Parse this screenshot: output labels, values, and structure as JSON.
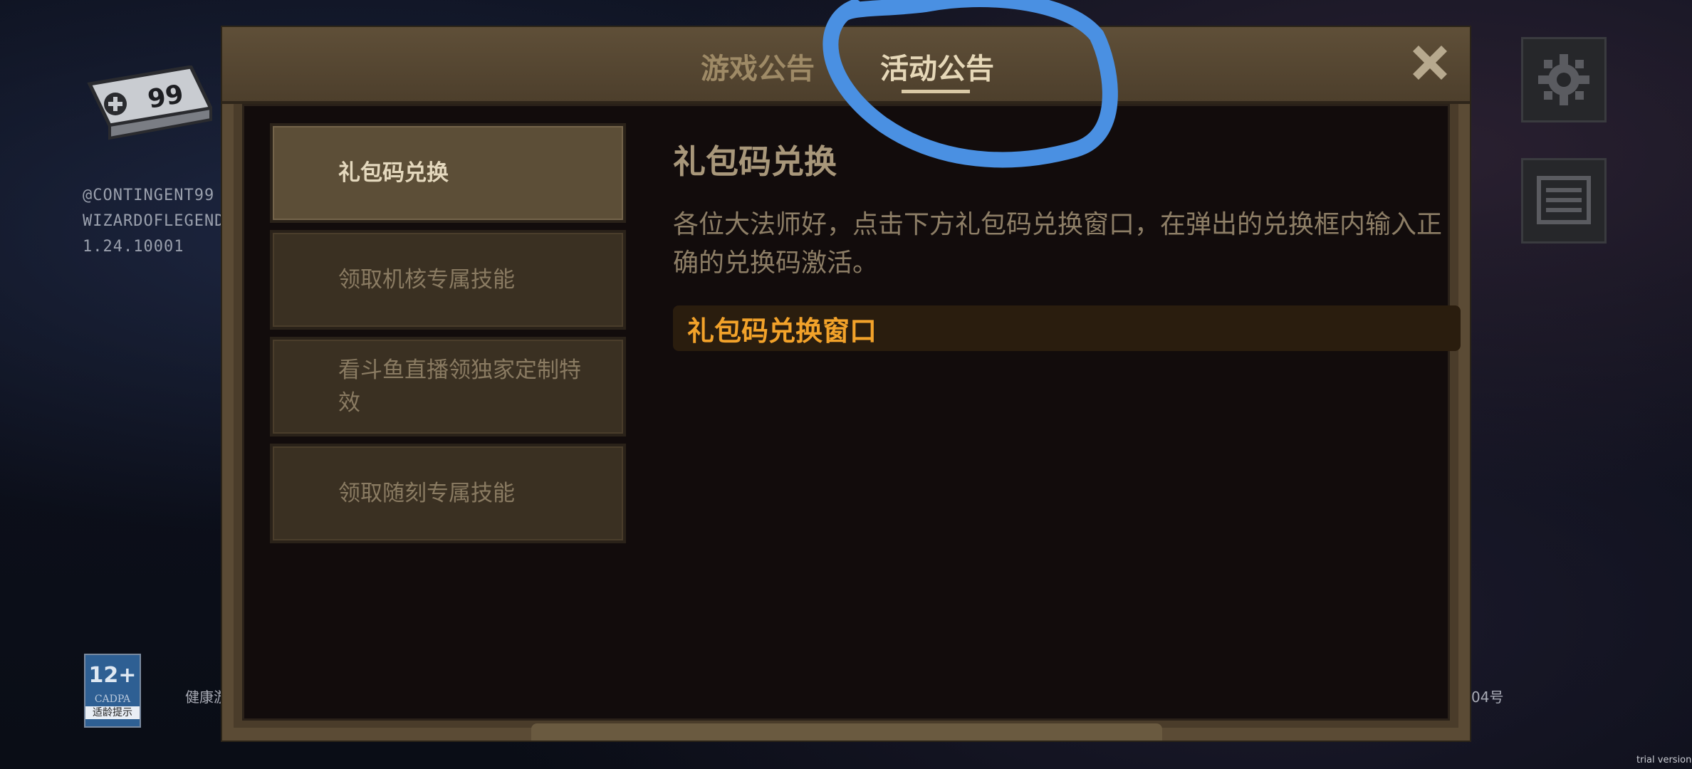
{
  "left_panel": {
    "controller_count": "99",
    "credit_line_1": "@CONTINGENT99",
    "credit_line_2": "WIZARDOFLEGEND",
    "version": "1.24.10001",
    "age_rating": {
      "number": "12+",
      "org": "CADPA",
      "tip": "适龄提示"
    },
    "health_text_visible": "健康游",
    "license_text_visible": "04号",
    "trial_label": "trial version"
  },
  "right_panel": {
    "settings_icon": "gear-icon",
    "list_icon": "list-icon"
  },
  "dialog": {
    "tabs": [
      {
        "label": "游戏公告",
        "active": false
      },
      {
        "label": "活动公告",
        "active": true
      }
    ],
    "close_icon": "close-icon",
    "menu": [
      {
        "label": "礼包码兑换",
        "active": true
      },
      {
        "label": "领取机核专属技能",
        "active": false
      },
      {
        "label": "看斗鱼直播领独家定制特效",
        "active": false
      },
      {
        "label": "领取随刻专属技能",
        "active": false
      }
    ],
    "content": {
      "title": "礼包码兑换",
      "body": "各位大法师好，点击下方礼包码兑换窗口，在弹出的兑换框内输入正确的兑换码激活。",
      "link_label": "礼包码兑换窗口"
    }
  },
  "colors": {
    "link": "#f2a22a",
    "annotation": "#4a90e2",
    "frame": "#5b4b35"
  }
}
